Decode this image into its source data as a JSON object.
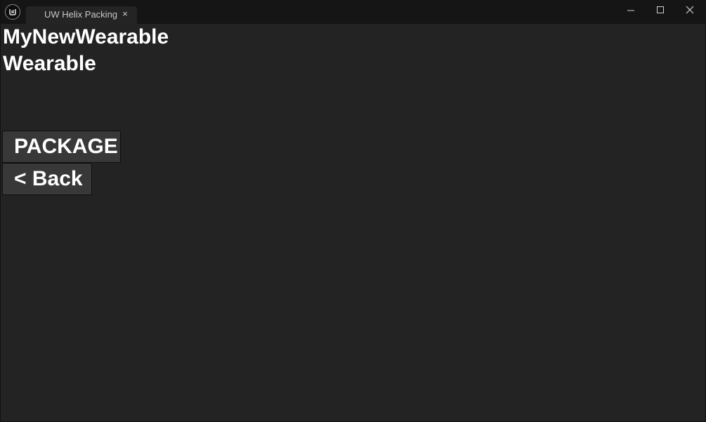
{
  "window": {
    "tab_title": "UW Helix Packing",
    "tab_close_glyph": "×",
    "controls": {
      "minimize_icon": "minimize-icon",
      "maximize_icon": "maximize-icon",
      "close_icon": "close-icon"
    }
  },
  "content": {
    "item_name": "MyNewWearable",
    "item_type": "Wearable",
    "package_label": "PACKAGE",
    "back_label": "< Back"
  },
  "colors": {
    "background": "#232323",
    "titlebar": "#151515",
    "button": "#383838",
    "text": "#ffffff"
  }
}
